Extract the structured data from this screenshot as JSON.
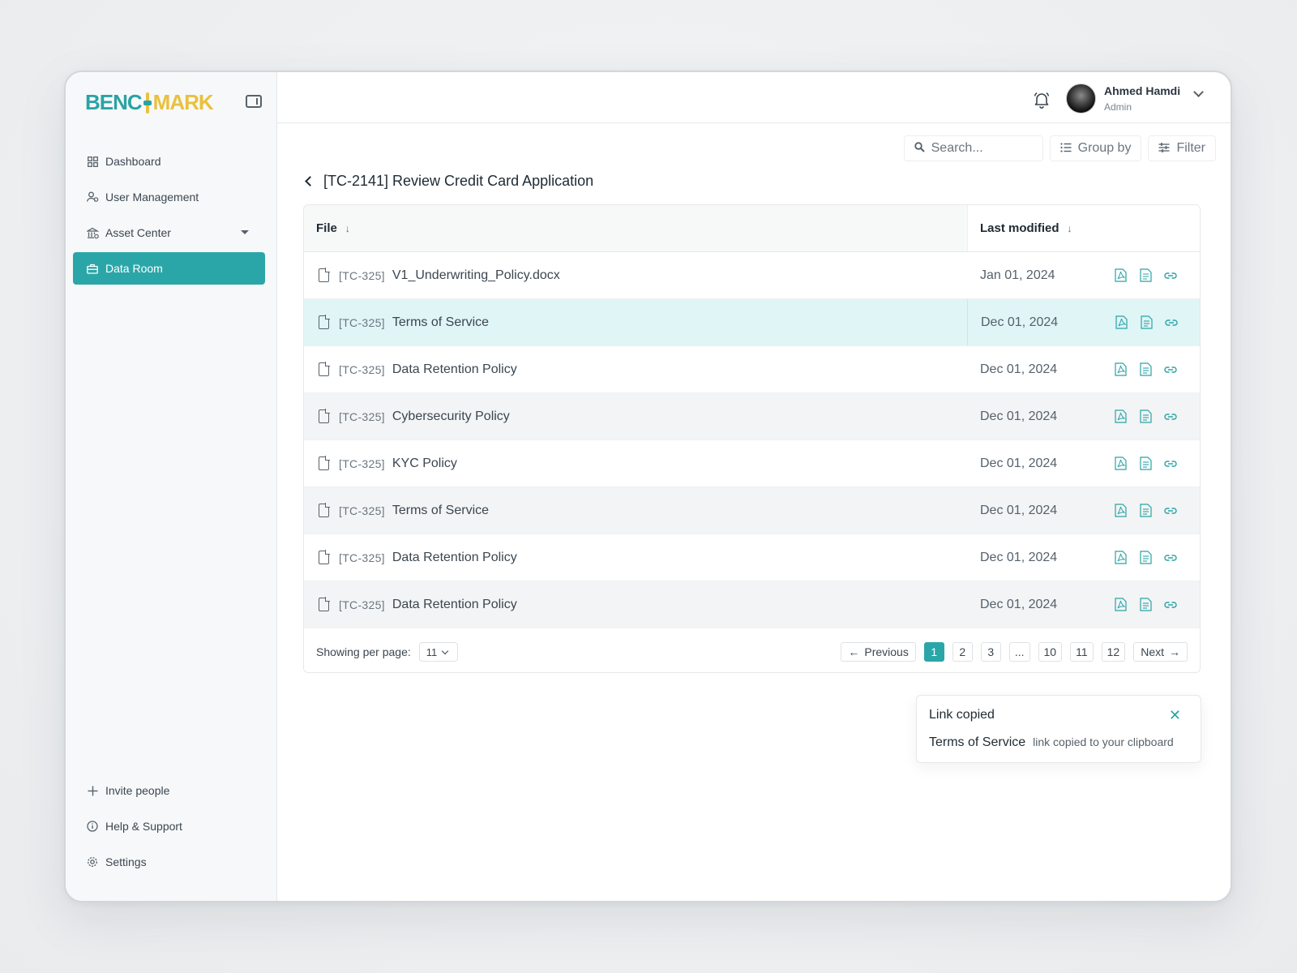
{
  "brand": {
    "part1": "BENC",
    "part2": "MARK"
  },
  "sidebar": {
    "items": [
      {
        "label": "Dashboard",
        "icon": "dashboard-icon"
      },
      {
        "label": "User Management",
        "icon": "users-icon"
      },
      {
        "label": "Asset Center",
        "icon": "bank-icon"
      },
      {
        "label": "Data Room",
        "icon": "briefcase-icon",
        "active": true
      }
    ],
    "bottom": [
      {
        "label": "Invite people",
        "icon": "plus-icon"
      },
      {
        "label": "Help & Support",
        "icon": "info-icon"
      },
      {
        "label": "Settings",
        "icon": "gear-icon"
      }
    ]
  },
  "header": {
    "user_name": "Ahmed Hamdi",
    "user_role": "Admin"
  },
  "toolbar": {
    "search_placeholder": "Search...",
    "group_by": "Group by",
    "filter": "Filter"
  },
  "page": {
    "title": "[TC-2141] Review Credit Card Application"
  },
  "table": {
    "columns": [
      "File",
      "Last modified"
    ],
    "rows": [
      {
        "code": "[TC-325]",
        "name": "V1_Underwriting_Policy.docx",
        "date": "Jan 01, 2024"
      },
      {
        "code": "[TC-325]",
        "name": "Terms of Service",
        "date": "Dec 01, 2024"
      },
      {
        "code": "[TC-325]",
        "name": "Data Retention Policy",
        "date": "Dec 01, 2024"
      },
      {
        "code": "[TC-325]",
        "name": "Cybersecurity Policy",
        "date": "Dec 01, 2024"
      },
      {
        "code": "[TC-325]",
        "name": "KYC Policy",
        "date": "Dec 01, 2024"
      },
      {
        "code": "[TC-325]",
        "name": "Terms of Service",
        "date": "Dec 01, 2024"
      },
      {
        "code": "[TC-325]",
        "name": "Data Retention Policy",
        "date": "Dec 01, 2024"
      },
      {
        "code": "[TC-325]",
        "name": "Data Retention Policy",
        "date": "Dec 01, 2024"
      }
    ]
  },
  "pagination": {
    "per_page_label": "Showing per page:",
    "per_page_value": "11",
    "previous": "Previous",
    "next": "Next",
    "pages": [
      "1",
      "2",
      "3",
      "...",
      "10",
      "11",
      "12"
    ],
    "current": "1"
  },
  "toast": {
    "title": "Link copied",
    "file": "Terms of Service",
    "message": "link copied to your clipboard"
  },
  "colors": {
    "accent": "#2ba6a8",
    "brand_yellow": "#e9c13c",
    "highlight_row": "#e0f5f6"
  }
}
